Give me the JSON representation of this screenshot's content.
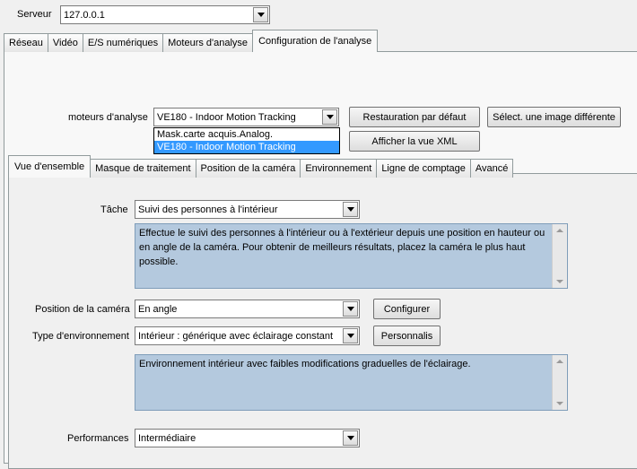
{
  "server": {
    "label": "Serveur",
    "value": "127.0.0.1"
  },
  "main_tabs": [
    {
      "label": "Réseau"
    },
    {
      "label": "Vidéo"
    },
    {
      "label": "E/S numériques"
    },
    {
      "label": "Moteurs d'analyse"
    },
    {
      "label": "Configuration de l'analyse"
    }
  ],
  "engine": {
    "label": "moteurs d'analyse",
    "value": "VE180 - Indoor Motion Tracking",
    "options": [
      "Mask.carte acquis.Analog.",
      "VE180 - Indoor Motion Tracking"
    ]
  },
  "buttons": {
    "restore": "Restauration par défaut",
    "select_image": "Sélect. une image différente",
    "show_xml": "Afficher la vue XML",
    "configure": "Configurer",
    "customize": "Personnalis"
  },
  "sub_tabs": [
    {
      "label": "Vue d'ensemble"
    },
    {
      "label": "Masque de traitement"
    },
    {
      "label": "Position de la caméra"
    },
    {
      "label": "Environnement"
    },
    {
      "label": "Ligne de comptage"
    },
    {
      "label": "Avancé"
    }
  ],
  "task": {
    "label": "Tâche",
    "value": "Suivi des personnes à l'intérieur",
    "description": "Effectue le suivi des personnes à l'intérieur ou à l'extérieur depuis une position en hauteur ou en angle de la caméra. Pour obtenir de meilleurs résultats, placez la caméra le plus haut possible."
  },
  "camera_position": {
    "label": "Position de la caméra",
    "value": "En angle"
  },
  "environment": {
    "label": "Type d'environnement",
    "value": "Intérieur : générique avec éclairage constant",
    "description": "Environnement intérieur avec faibles modifications graduelles de l'éclairage."
  },
  "performance": {
    "label": "Performances",
    "value": "Intermédiaire"
  }
}
